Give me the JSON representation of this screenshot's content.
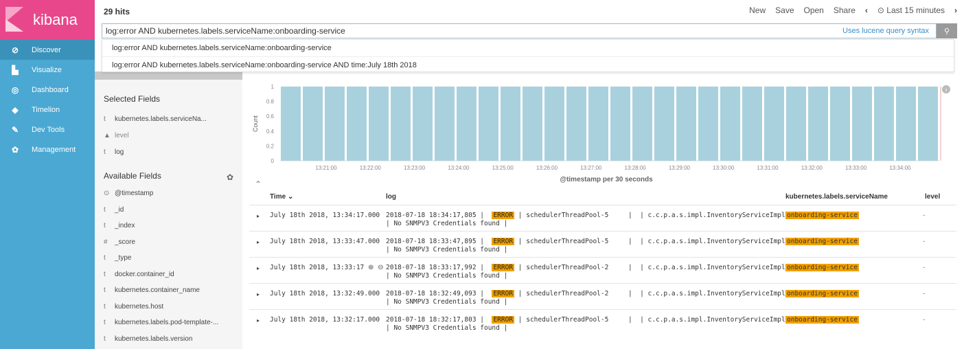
{
  "nav": {
    "brand": "kibana",
    "items": [
      {
        "label": "Discover",
        "icon": "compass-icon",
        "glyph": "⊘"
      },
      {
        "label": "Visualize",
        "icon": "bar-chart-icon",
        "glyph": "▙"
      },
      {
        "label": "Dashboard",
        "icon": "dashboard-icon",
        "glyph": "◎"
      },
      {
        "label": "Timelion",
        "icon": "timelion-icon",
        "glyph": "◆"
      },
      {
        "label": "Dev Tools",
        "icon": "wrench-icon",
        "glyph": "✎"
      },
      {
        "label": "Management",
        "icon": "gear-icon",
        "glyph": "✿"
      }
    ]
  },
  "header": {
    "hits": "29 hits",
    "new": "New",
    "save": "Save",
    "open": "Open",
    "share": "Share",
    "prev": "‹",
    "time_range": "⊙ Last 15 minutes",
    "next": "›"
  },
  "query": {
    "value": "log:error AND kubernetes.labels.serviceName:onboarding-service",
    "hint": "Uses lucene query syntax",
    "button_icon": "search-icon",
    "button_glyph": "⚲"
  },
  "suggestions": [
    "log:error AND kubernetes.labels.serviceName:onboarding-service",
    "log:error AND kubernetes.labels.serviceName:onboarding-service AND time:July 18th 2018"
  ],
  "fields": {
    "selected_title": "Selected Fields",
    "selected": [
      {
        "type": "t",
        "name": "kubernetes.labels.serviceNa..."
      },
      {
        "type": "▲",
        "name": "level"
      },
      {
        "type": "t",
        "name": "log"
      }
    ],
    "available_title": "Available Fields",
    "available": [
      {
        "type": "⊙",
        "name": "@timestamp"
      },
      {
        "type": "t",
        "name": "_id"
      },
      {
        "type": "t",
        "name": "_index"
      },
      {
        "type": "#",
        "name": "_score"
      },
      {
        "type": "t",
        "name": "_type"
      },
      {
        "type": "t",
        "name": "docker.container_id"
      },
      {
        "type": "t",
        "name": "kubernetes.container_name"
      },
      {
        "type": "t",
        "name": "kubernetes.host"
      },
      {
        "type": "t",
        "name": "kubernetes.labels.pod-template-..."
      },
      {
        "type": "t",
        "name": "kubernetes.labels.version"
      }
    ]
  },
  "chart_data": {
    "type": "bar",
    "ylabel": "Count",
    "xlabel": "@timestamp per 30 seconds",
    "ylim": [
      0,
      1
    ],
    "yticks": [
      "0",
      "0.2",
      "0.4",
      "0.6",
      "0.8",
      "1"
    ],
    "xticks": [
      "13:21:00",
      "13:22:00",
      "13:23:00",
      "13:24:00",
      "13:25:00",
      "13:26:00",
      "13:27:00",
      "13:28:00",
      "13:29:00",
      "13:30:00",
      "13:31:00",
      "13:32:00",
      "13:33:00",
      "13:34:00"
    ],
    "values": [
      1,
      1,
      1,
      1,
      1,
      1,
      1,
      1,
      1,
      1,
      1,
      1,
      1,
      1,
      1,
      1,
      1,
      1,
      1,
      1,
      1,
      1,
      1,
      1,
      1,
      1,
      1,
      1,
      1,
      1
    ],
    "bar_color": "#a8d1dd"
  },
  "table": {
    "headers": {
      "time": "Time",
      "log": "log",
      "service": "kubernetes.labels.serviceName",
      "level": "level"
    },
    "rows": [
      {
        "time": "July 18th 2018, 13:34:17.000",
        "log_ts": "2018-07-18 18:34:17,805 |",
        "error": "ERROR",
        "log_rest": "| schedulerThreadPool-5     |  | c.c.p.a.s.impl.InventoryServiceImpl",
        "log2": "| No SNMPV3 Credentials found |",
        "service": "onboarding-service",
        "level": "-"
      },
      {
        "time": "July 18th 2018, 13:33:47.000",
        "log_ts": "2018-07-18 18:33:47,895 |",
        "error": "ERROR",
        "log_rest": "| schedulerThreadPool-5     |  | c.c.p.a.s.impl.InventoryServiceImpl",
        "log2": "| No SNMPV3 Credentials found |",
        "service": "onboarding-service",
        "level": "-"
      },
      {
        "time": "July 18th 2018, 13:33:17",
        "log_ts": "2018-07-18 18:33:17,992 |",
        "error": "ERROR",
        "log_rest": "| schedulerThreadPool-2     |  | c.c.p.a.s.impl.InventoryServiceImpl",
        "log2": "| No SNMPV3 Credentials found |",
        "service": "onboarding-service",
        "level": "-"
      },
      {
        "time": "July 18th 2018, 13:32:49.000",
        "log_ts": "2018-07-18 18:32:49,093 |",
        "error": "ERROR",
        "log_rest": "| schedulerThreadPool-2     |  | c.c.p.a.s.impl.InventoryServiceImpl",
        "log2": "| No SNMPV3 Credentials found |",
        "service": "onboarding-service",
        "level": "-"
      },
      {
        "time": "July 18th 2018, 13:32:17.000",
        "log_ts": "2018-07-18 18:32:17,803 |",
        "error": "ERROR",
        "log_rest": "| schedulerThreadPool-5     |  | c.c.p.a.s.impl.InventoryServiceImpl",
        "log2": "| No SNMPV3 Credentials found |",
        "service": "onboarding-service",
        "level": "-"
      }
    ]
  }
}
